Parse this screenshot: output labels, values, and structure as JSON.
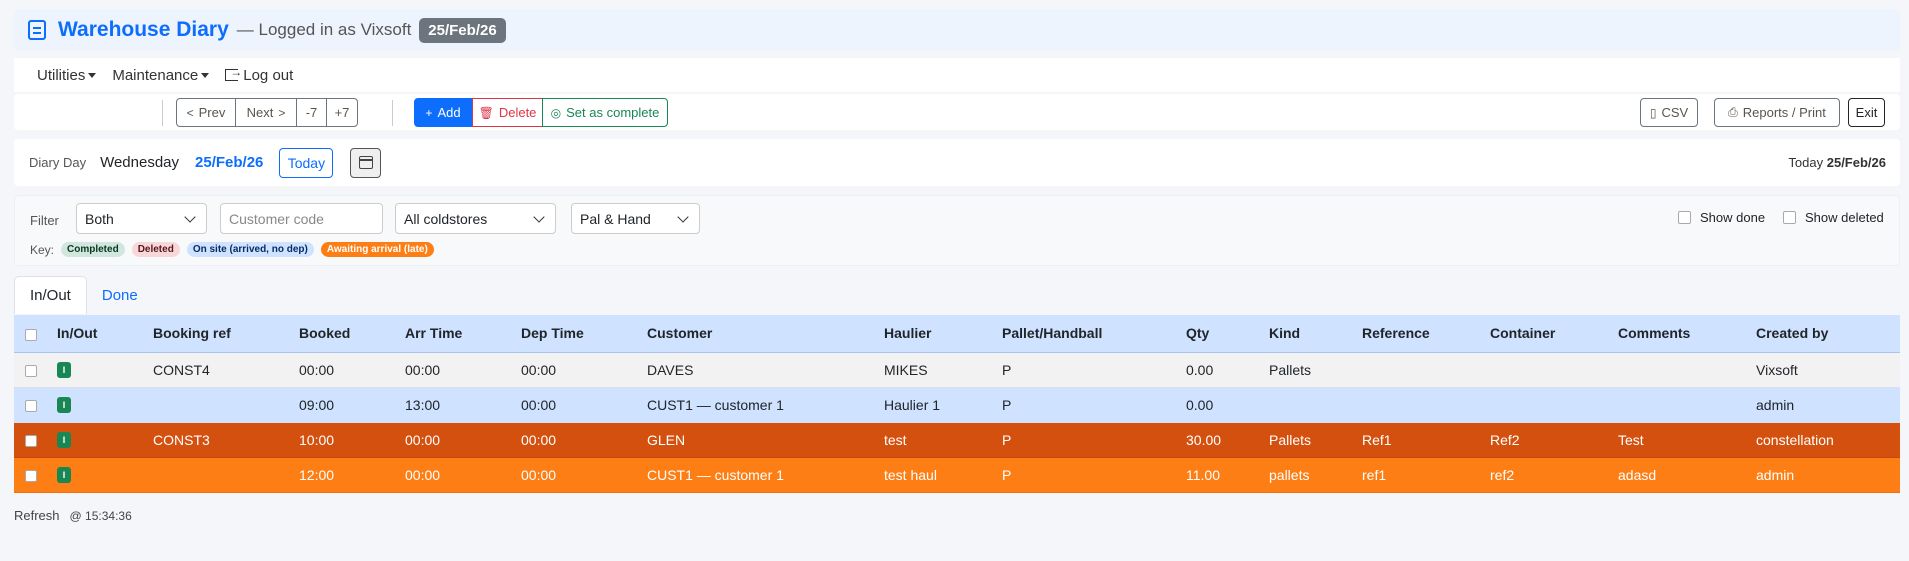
{
  "header": {
    "title": "Warehouse Diary",
    "subtitle": "— Logged in as Vixsoft",
    "date_badge": "25/Feb/26"
  },
  "menu": {
    "utilities": "Utilities",
    "maintenance": "Maintenance",
    "logout": "Log out"
  },
  "toolbar": {
    "prev": "Prev",
    "next": "Next",
    "minus7": "-7",
    "plus7": "+7",
    "add": "Add",
    "delete": "Delete",
    "complete": "Set as complete",
    "csv": "CSV",
    "reports": "Reports / Print",
    "exit": "Exit"
  },
  "day": {
    "label": "Diary Day",
    "weekday": "Wednesday",
    "date": "25/Feb/26",
    "today_button": "Today",
    "today_label": "Today",
    "today_date": "25/Feb/26"
  },
  "filter": {
    "label": "Filter",
    "direction": "Both",
    "customer_placeholder": "Customer code",
    "coldstore": "All coldstores",
    "handling": "Pal & Hand",
    "show_done": "Show done",
    "show_deleted": "Show deleted",
    "key_label": "Key:",
    "key": {
      "completed": "Completed",
      "deleted": "Deleted",
      "onsite": "On site (arrived, no dep)",
      "late": "Awaiting arrival (late)"
    }
  },
  "tabs": [
    "In/Out",
    "Done"
  ],
  "table": {
    "columns": [
      "In/Out",
      "Booking ref",
      "Booked",
      "Arr Time",
      "Dep Time",
      "Customer",
      "Haulier",
      "Pallet/Handball",
      "Qty",
      "Kind",
      "Reference",
      "Container",
      "Comments",
      "Created by"
    ],
    "rows": [
      {
        "io": "I",
        "booking_ref": "CONST4",
        "booked": "00:00",
        "arr": "00:00",
        "dep": "00:00",
        "customer": "DAVES",
        "haulier": "MIKES",
        "pallet": "P",
        "qty": "0.00",
        "kind": "Pallets",
        "reference": "",
        "container": "",
        "comments": "",
        "created_by": "Vixsoft"
      },
      {
        "io": "I",
        "booking_ref": "",
        "booked": "09:00",
        "arr": "13:00",
        "dep": "00:00",
        "customer": "CUST1 — customer 1",
        "haulier": "Haulier 1",
        "pallet": "P",
        "qty": "0.00",
        "kind": "",
        "reference": "",
        "container": "",
        "comments": "",
        "created_by": "admin"
      },
      {
        "io": "I",
        "booking_ref": "CONST3",
        "booked": "10:00",
        "arr": "00:00",
        "dep": "00:00",
        "customer": "GLEN",
        "haulier": "test",
        "pallet": "P",
        "qty": "30.00",
        "kind": "Pallets",
        "reference": "Ref1",
        "container": "Ref2",
        "comments": "Test",
        "created_by": "constellation"
      },
      {
        "io": "I",
        "booking_ref": "",
        "booked": "12:00",
        "arr": "00:00",
        "dep": "00:00",
        "customer": "CUST1 — customer 1",
        "haulier": "test haul",
        "pallet": "P",
        "qty": "11.00",
        "kind": "pallets",
        "reference": "ref1",
        "container": "ref2",
        "comments": "adasd",
        "created_by": "admin"
      }
    ]
  },
  "footer": {
    "refresh": "Refresh",
    "time": "@ 15:34:36"
  },
  "colors": {
    "accent": "#0d6efd",
    "header_bg": "#cfe2ff",
    "row_onsite": "#cfe2ff",
    "row_dark_orange": "#d4500e",
    "row_late": "#fd7e14",
    "badge_in": "#198754"
  }
}
